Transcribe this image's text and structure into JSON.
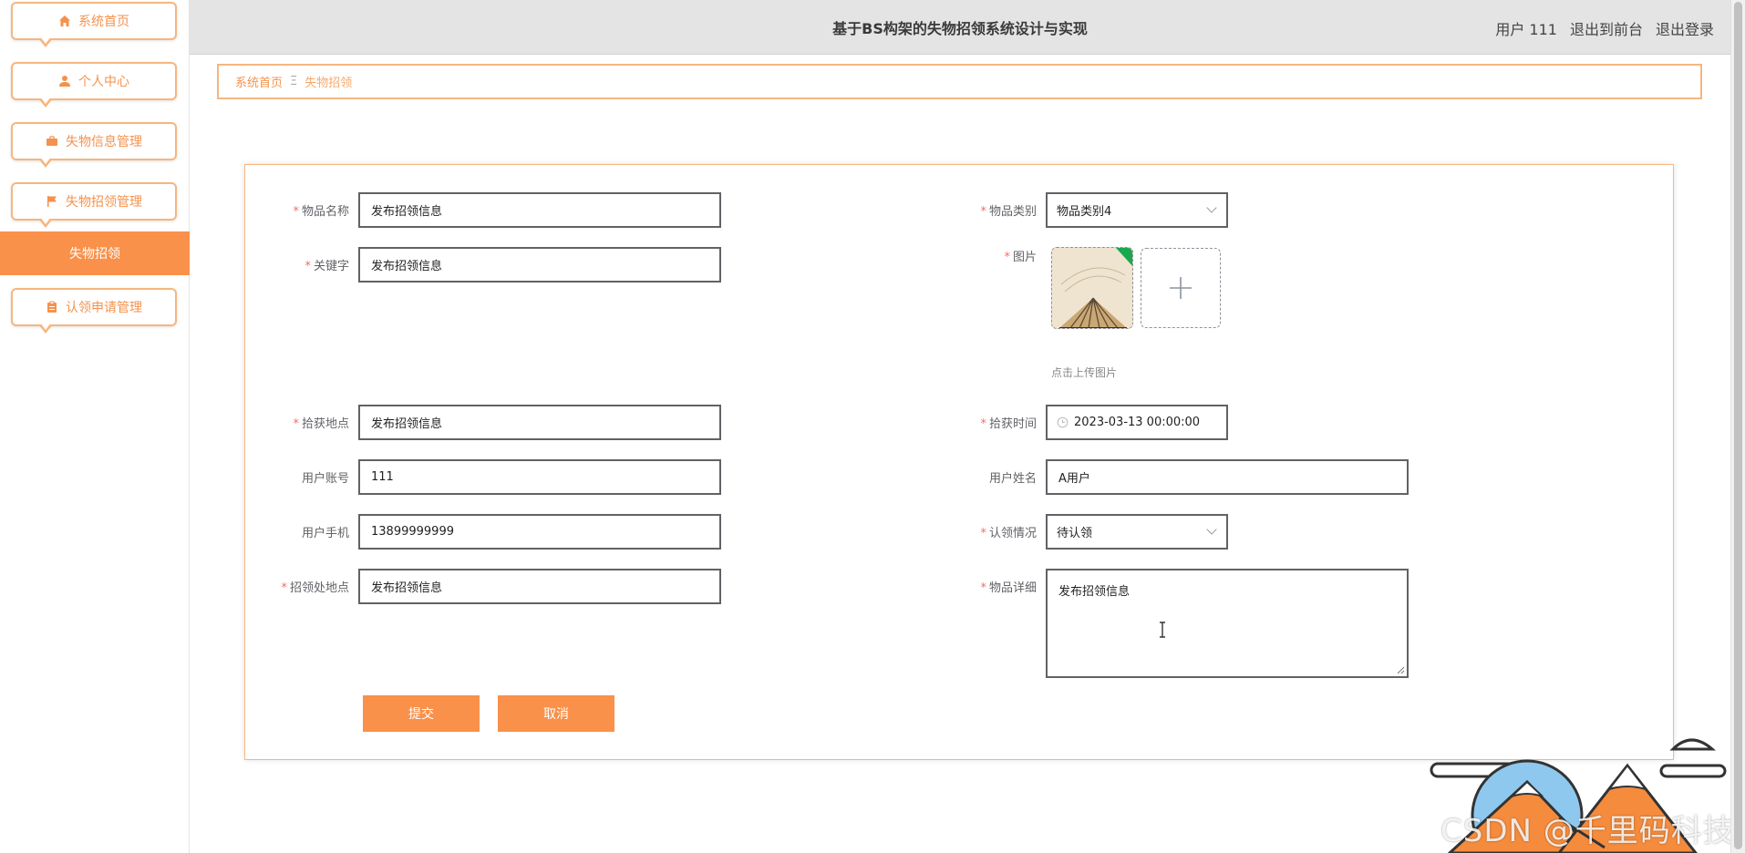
{
  "app": {
    "title": "基于BS构架的失物招领系统设计与实现",
    "user_label": "用户 111",
    "front_link": "退出到前台",
    "logout_link": "退出登录"
  },
  "sidebar": {
    "items": [
      {
        "label": "系统首页",
        "icon": "home-icon"
      },
      {
        "label": "个人中心",
        "icon": "user-icon"
      },
      {
        "label": "失物信息管理",
        "icon": "briefcase-icon"
      },
      {
        "label": "失物招领管理",
        "icon": "flag-icon"
      },
      {
        "label": "认领申请管理",
        "icon": "clipboard-icon"
      }
    ],
    "active_sub": "失物招领"
  },
  "breadcrumb": {
    "home": "系统首页",
    "separator": "Ξ",
    "current": "失物招领"
  },
  "form": {
    "item_name": {
      "label": "物品名称",
      "value": "发布招领信息"
    },
    "keyword": {
      "label": "关键字",
      "value": "发布招领信息"
    },
    "found_place": {
      "label": "拾获地点",
      "value": "发布招领信息"
    },
    "user_account": {
      "label": "用户账号",
      "value": "111"
    },
    "user_phone": {
      "label": "用户手机",
      "value": "13899999999"
    },
    "claim_place": {
      "label": "招领处地点",
      "value": "发布招领信息"
    },
    "category": {
      "label": "物品类别",
      "value": "物品类别4"
    },
    "image": {
      "label": "图片",
      "hint": "点击上传图片"
    },
    "found_time": {
      "label": "拾获时间",
      "value": "2023-03-13 00:00:00"
    },
    "user_name": {
      "label": "用户姓名",
      "value": "A用户"
    },
    "claim_status": {
      "label": "认领情况",
      "value": "待认领"
    },
    "detail": {
      "label": "物品详细",
      "value": "发布招领信息"
    },
    "submit": "提交",
    "cancel": "取消"
  },
  "watermark": "CSDN @千里码科技",
  "colors": {
    "accent": "#f9914a",
    "border": "#f6b67f",
    "required": "#f56c6c"
  }
}
